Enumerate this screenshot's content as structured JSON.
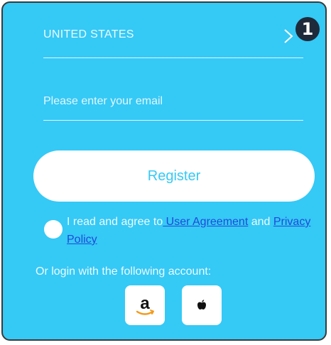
{
  "step_badge": "1",
  "country": {
    "label": "UNITED STATES",
    "chevron_icon": "chevron-right-icon"
  },
  "email": {
    "value": "",
    "placeholder": "Please enter your email"
  },
  "register_label": "Register",
  "agreement": {
    "prefix": "I read and agree to",
    "user_agreement": " User Agreement",
    "and": " and ",
    "privacy_policy": "Privacy Policy",
    "checked": false
  },
  "social": {
    "heading": "Or login with the following account:",
    "providers": [
      {
        "name": "amazon",
        "icon": "amazon-logo-icon"
      },
      {
        "name": "apple",
        "icon": "apple-logo-icon"
      }
    ]
  },
  "colors": {
    "background": "#35c9f6",
    "link": "#1f4bd8",
    "badge": "#1e2a3a"
  }
}
